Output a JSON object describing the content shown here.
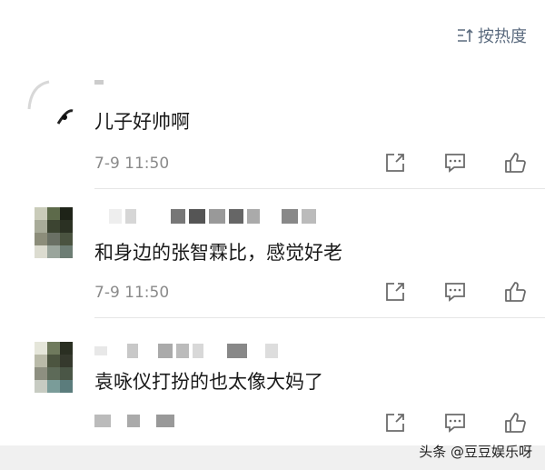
{
  "sort": {
    "label": "按热度",
    "icon": "sort-icon"
  },
  "comments": [
    {
      "text": "儿子好帅啊",
      "time": "7-9 11:50"
    },
    {
      "text": "和身边的张智霖比，感觉好老",
      "time": "7-9 11:50"
    },
    {
      "text": "袁咏仪打扮的也太像大妈了",
      "time": ""
    }
  ],
  "actions": {
    "share_icon": "share-icon",
    "reply_icon": "reply-icon",
    "like_icon": "thumbs-up-icon"
  },
  "watermark": "头条 @豆豆娱乐呀",
  "colors": {
    "icon": "#6b6b6b",
    "time": "#8a8a8a",
    "sort": "#5b6b7f"
  }
}
